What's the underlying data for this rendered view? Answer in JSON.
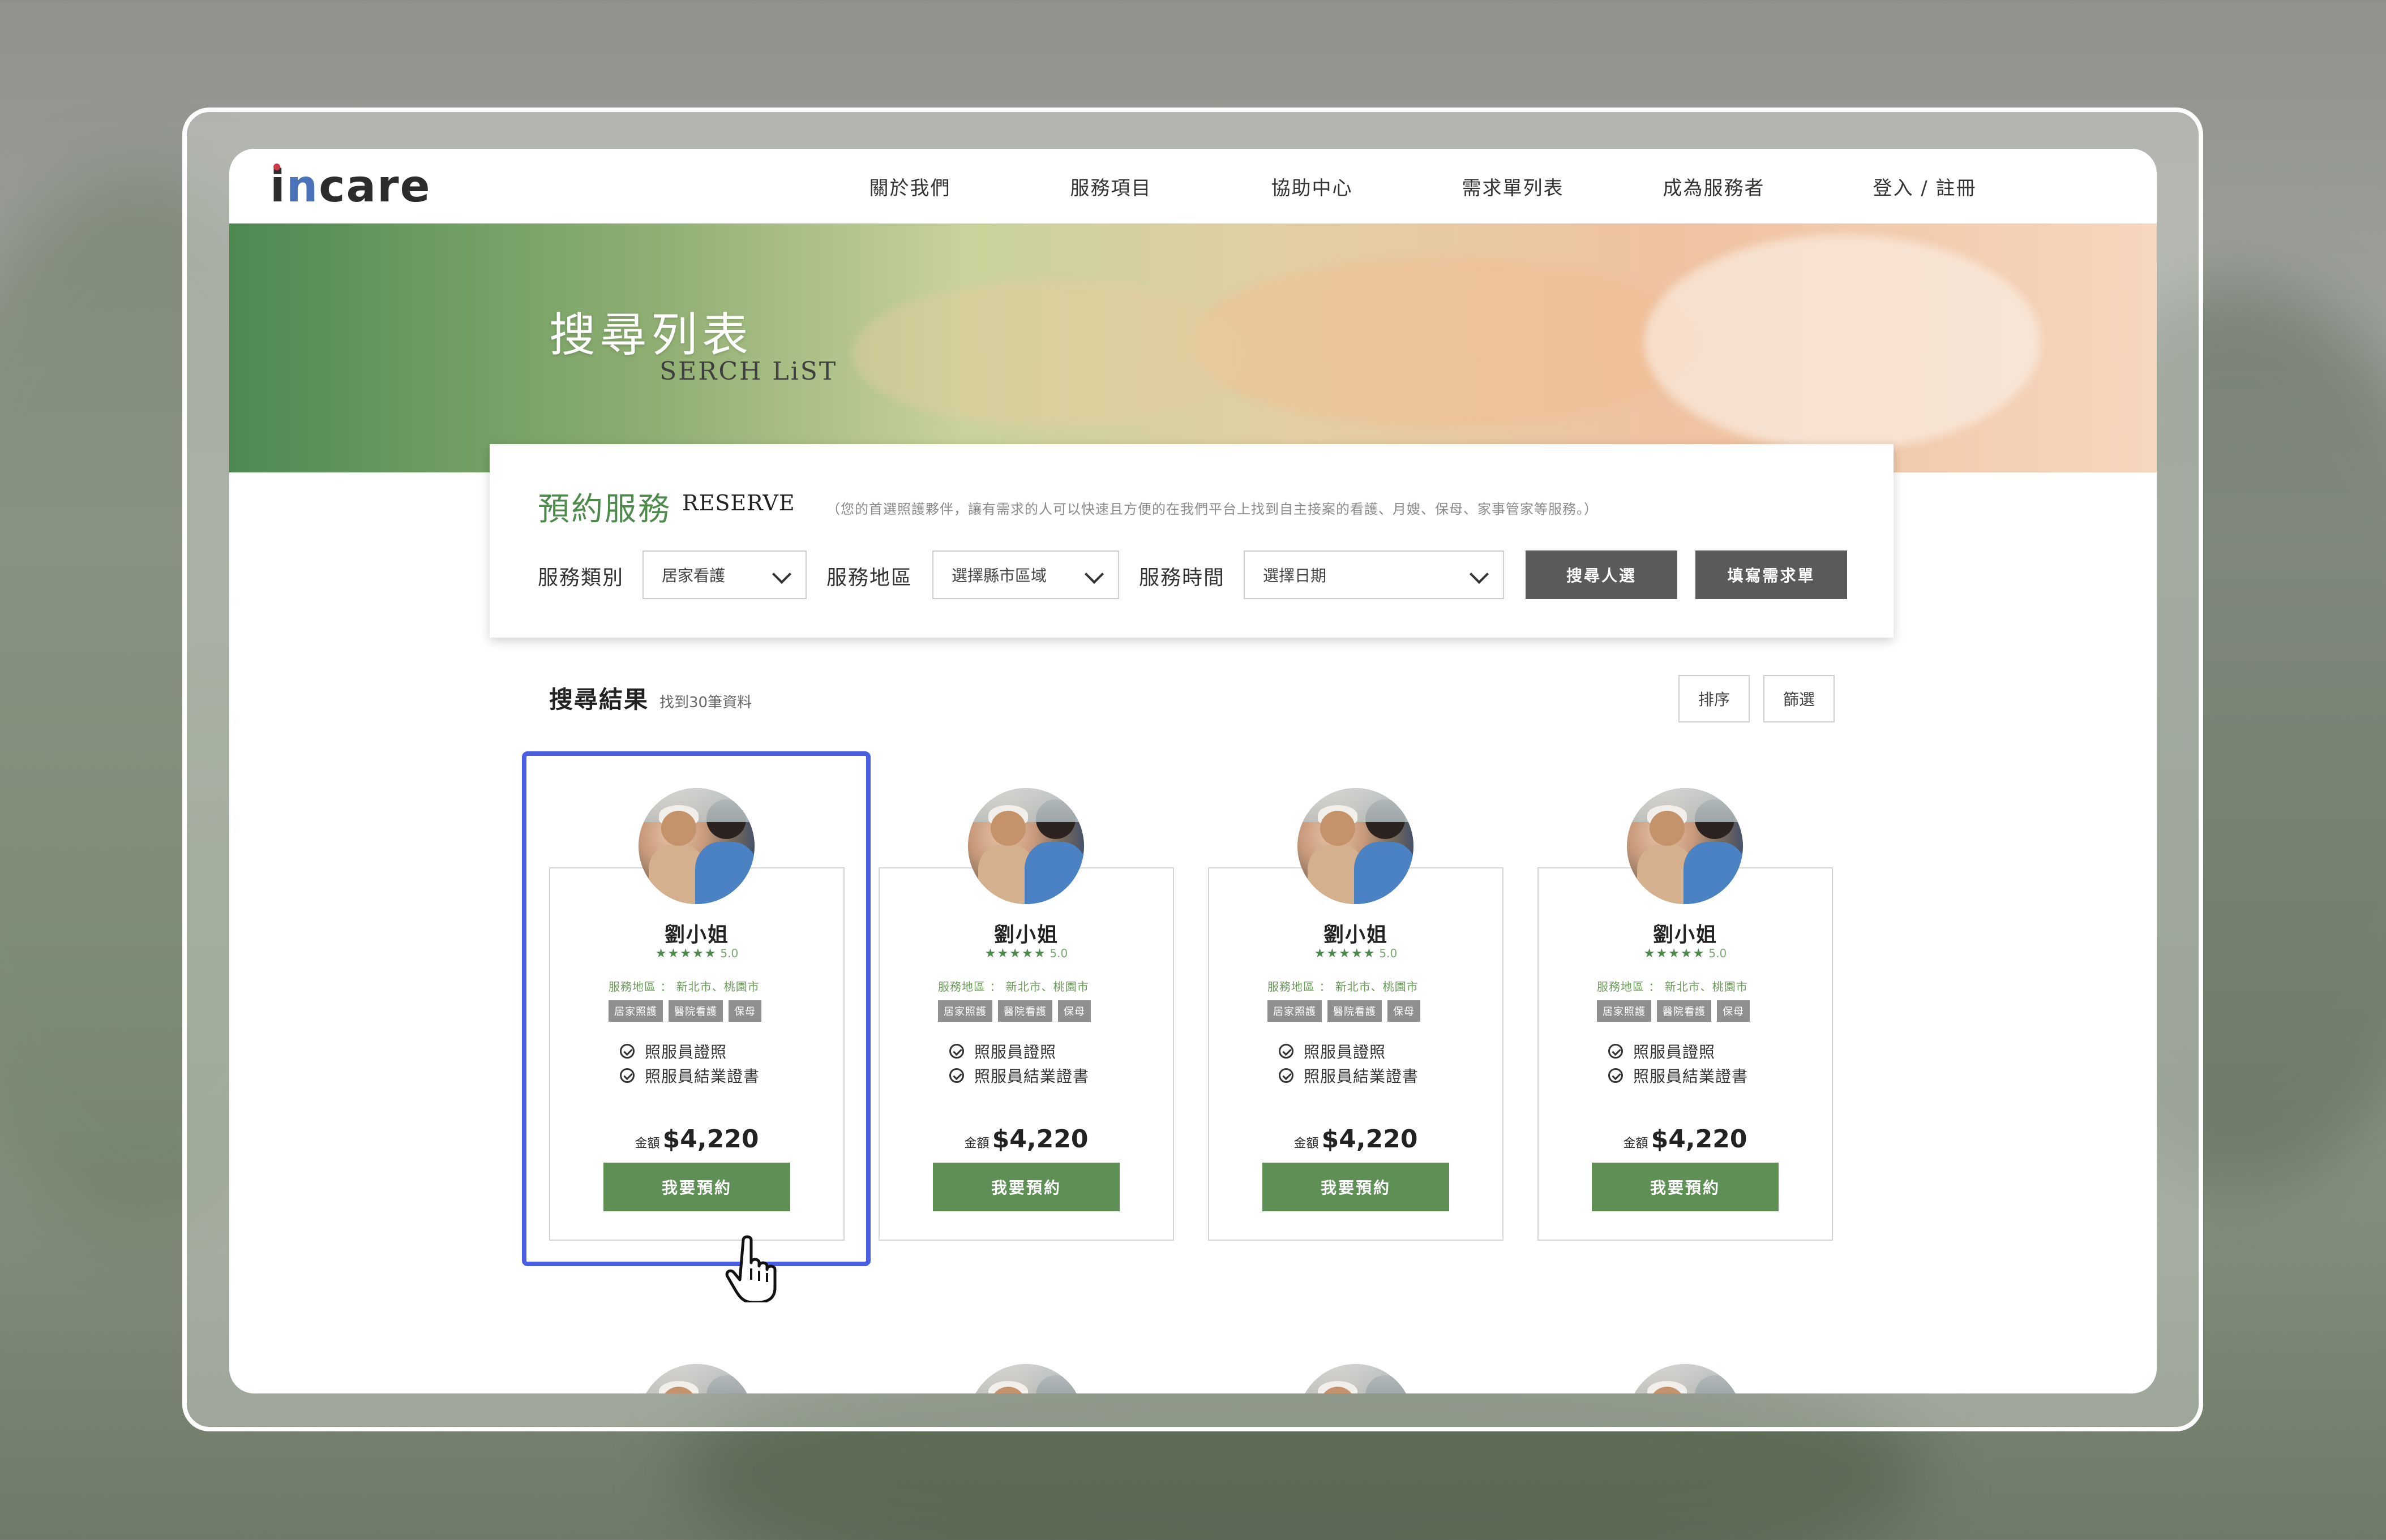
{
  "logo": {
    "i": "i",
    "n": "n",
    "rest": " care"
  },
  "nav": [
    "關於我們",
    "服務項目",
    "協助中心",
    "需求單列表",
    "成為服務者",
    "登入 / 註冊"
  ],
  "hero": {
    "title": "搜尋列表",
    "subtitle": "SERCH LiST"
  },
  "reserve": {
    "title": "預約服務",
    "title_en": "RESERVE",
    "note": "（您的首選照護夥伴，讓有需求的人可以快速且方便的在我們平台上找到自主接案的看護、月嫂、保母、家事管家等服務。）",
    "fields": [
      {
        "label": "服務類別",
        "value": "居家看護"
      },
      {
        "label": "服務地區",
        "value": "選擇縣市區域"
      },
      {
        "label": "服務時間",
        "value": "選擇日期"
      }
    ],
    "btn_search": "搜尋人選",
    "btn_fill": "填寫需求單"
  },
  "results": {
    "title": "搜尋結果",
    "count": "找到30筆資料",
    "sort": "排序",
    "filter": "篩選"
  },
  "cards": [
    {
      "name": "劉小姐",
      "stars": "★★★★★",
      "rating": "5.0",
      "area": "服務地區 ： 新北市、桃園市",
      "tags": [
        "居家照護",
        "醫院看護",
        "保母"
      ],
      "certs": [
        "照服員證照",
        "照服員結業證書"
      ],
      "price_label": "金額",
      "price": "$4,220",
      "btn": "我要預約"
    },
    {
      "name": "劉小姐",
      "stars": "★★★★★",
      "rating": "5.0",
      "area": "服務地區 ： 新北市、桃園市",
      "tags": [
        "居家照護",
        "醫院看護",
        "保母"
      ],
      "certs": [
        "照服員證照",
        "照服員結業證書"
      ],
      "price_label": "金額",
      "price": "$4,220",
      "btn": "我要預約"
    },
    {
      "name": "劉小姐",
      "stars": "★★★★★",
      "rating": "5.0",
      "area": "服務地區 ： 新北市、桃園市",
      "tags": [
        "居家照護",
        "醫院看護",
        "保母"
      ],
      "certs": [
        "照服員證照",
        "照服員結業證書"
      ],
      "price_label": "金額",
      "price": "$4,220",
      "btn": "我要預約"
    },
    {
      "name": "劉小姐",
      "stars": "★★★★★",
      "rating": "5.0",
      "area": "服務地區 ： 新北市、桃園市",
      "tags": [
        "居家照護",
        "醫院看護",
        "保母"
      ],
      "certs": [
        "照服員證照",
        "照服員結業證書"
      ],
      "price_label": "金額",
      "price": "$4,220",
      "btn": "我要預約"
    }
  ],
  "colors": {
    "accent_green": "#5e8f55",
    "highlight_blue": "#4a5fe0",
    "dark_button": "#5a5a5a"
  },
  "icons": {
    "chevron": "chevron-down-icon",
    "check": "check-circle-icon",
    "cursor": "hand-pointer-icon"
  }
}
